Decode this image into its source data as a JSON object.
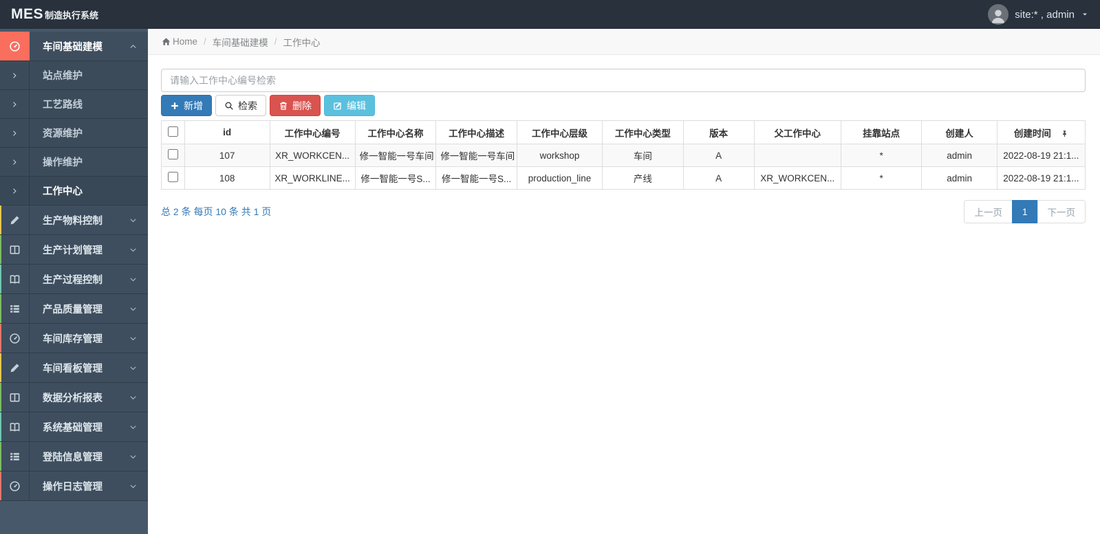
{
  "colors": {
    "navbar_bg": "#28313c",
    "sidebar_bg": "#47586a",
    "menu_item_bg": "#3e4e5e",
    "active_icon_bg": "#fa6e5e",
    "primary": "#337ab7",
    "danger": "#d9534f",
    "info": "#5bc0de"
  },
  "navbar": {
    "logo_primary": "MES",
    "logo_secondary": "制造执行系统",
    "user": "site:* , admin"
  },
  "sidebar": {
    "active_section": {
      "label": "车间基础建模",
      "icon": "gauge-icon",
      "chevron": "up"
    },
    "submenu": [
      {
        "label": "站点维护",
        "active": false
      },
      {
        "label": "工艺路线",
        "active": false
      },
      {
        "label": "资源维护",
        "active": false
      },
      {
        "label": "操作维护",
        "active": false
      },
      {
        "label": "工作中心",
        "active": true
      }
    ],
    "sections": [
      {
        "label": "生产物料控制",
        "icon": "pencil-icon",
        "accent": "#e9c64e"
      },
      {
        "label": "生产计划管理",
        "icon": "columns-icon",
        "accent": "#7cbd62"
      },
      {
        "label": "生产过程控制",
        "icon": "book-icon",
        "accent": "#6fc6b2"
      },
      {
        "label": "产品质量管理",
        "icon": "list-icon",
        "accent": "#7cbd62"
      },
      {
        "label": "车间库存管理",
        "icon": "gauge-icon",
        "accent": "#e3766c"
      },
      {
        "label": "车间看板管理",
        "icon": "pencil-icon",
        "accent": "#e9c64e"
      },
      {
        "label": "数据分析报表",
        "icon": "columns-icon",
        "accent": "#7cbd62"
      },
      {
        "label": "系统基础管理",
        "icon": "book-icon",
        "accent": "#6fc6b2"
      },
      {
        "label": "登陆信息管理",
        "icon": "list-icon",
        "accent": "#7cbd62"
      },
      {
        "label": "操作日志管理",
        "icon": "gauge-icon",
        "accent": "#e3766c"
      }
    ]
  },
  "breadcrumb": {
    "home": "Home",
    "items": [
      "车间基础建模",
      "工作中心"
    ]
  },
  "search": {
    "placeholder": "请输入工作中心编号检索"
  },
  "toolbar": {
    "buttons": [
      {
        "name": "add-button",
        "label": "新增",
        "icon": "plus-icon",
        "style": "primary"
      },
      {
        "name": "search-button",
        "label": "检索",
        "icon": "search-icon",
        "style": "default"
      },
      {
        "name": "delete-button",
        "label": "删除",
        "icon": "trash-icon",
        "style": "danger"
      },
      {
        "name": "edit-button",
        "label": "编辑",
        "icon": "edit-icon",
        "style": "info"
      }
    ]
  },
  "table": {
    "columns": [
      "",
      "id",
      "工作中心编号",
      "工作中心名称",
      "工作中心描述",
      "工作中心层级",
      "工作中心类型",
      "版本",
      "父工作中心",
      "挂靠站点",
      "创建人",
      "创建时间"
    ],
    "last_column_icon": "pin-icon",
    "rows": [
      [
        "107",
        "XR_WORKCEN...",
        "修一智能一号车间",
        "修一智能一号车间",
        "workshop",
        "车间",
        "A",
        "",
        "*",
        "admin",
        "2022-08-19 21:1..."
      ],
      [
        "108",
        "XR_WORKLINE...",
        "修一智能一号S...",
        "修一智能一号S...",
        "production_line",
        "产线",
        "A",
        "XR_WORKCEN...",
        "*",
        "admin",
        "2022-08-19 21:1..."
      ]
    ]
  },
  "pagination": {
    "summary": "总 2 条  每页 10 条  共 1 页",
    "prev": "上一页",
    "current": "1",
    "next": "下一页"
  }
}
